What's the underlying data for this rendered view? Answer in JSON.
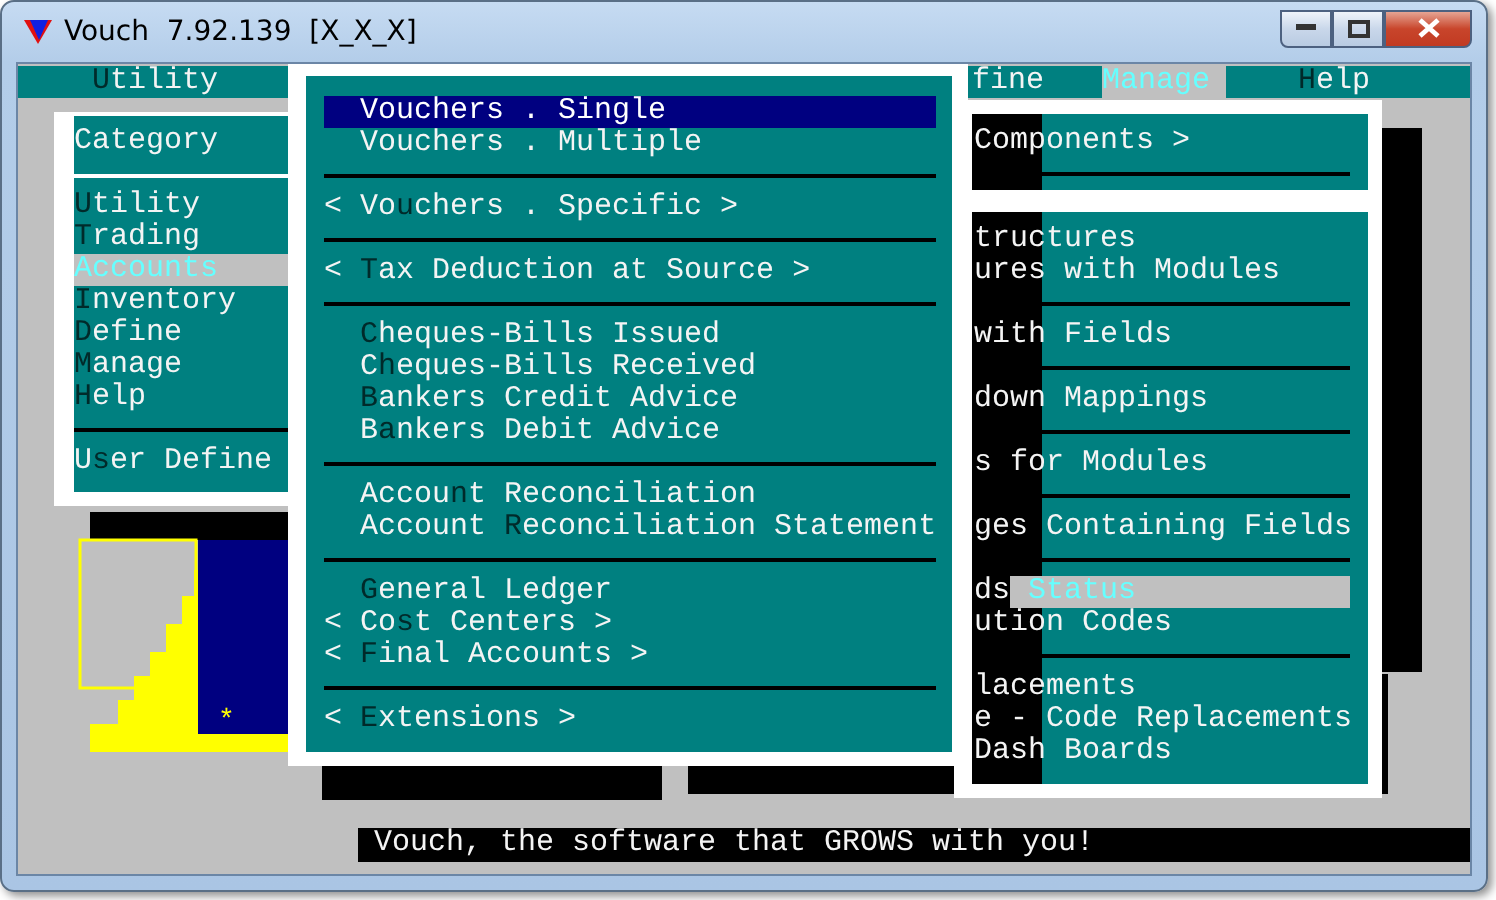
{
  "window": {
    "title": "Vouch  7.92.139  [X_X_X]"
  },
  "menu_bar": [
    {
      "hotkey": "U",
      "after": "tility",
      "selected": false
    },
    {
      "before": "fine",
      "selected": false
    },
    {
      "before": "Manage",
      "selected": true
    },
    {
      "hotkey": "H",
      "after": "elp",
      "selected": false
    }
  ],
  "left_panel": {
    "heading": "Category",
    "items": [
      {
        "hotkey": "U",
        "after": "tility",
        "selected": false
      },
      {
        "hotkey": "T",
        "after": "rading",
        "selected": false
      },
      {
        "before": "Accounts",
        "selected": true
      },
      {
        "hotkey": "I",
        "after": "nventory",
        "selected": false
      },
      {
        "hotkey": "D",
        "after": "efine",
        "selected": false
      },
      {
        "hotkey": "M",
        "after": "anage",
        "selected": false
      },
      {
        "hotkey": "H",
        "after": "elp",
        "selected": false
      }
    ],
    "footer_items": [
      {
        "before": "U",
        "hotkey": "s",
        "after": "er Define",
        "selected": false
      }
    ]
  },
  "accounts_menu": {
    "groups": [
      [
        {
          "kind": "command",
          "before": "Vouchers . Single",
          "selected": true
        },
        {
          "kind": "command",
          "before": "Vouchers . Multiple",
          "selected": false
        }
      ],
      [
        {
          "kind": "submenu",
          "before": "< Vo",
          "hotkey": "u",
          "after": "chers . Specific >",
          "selected": false
        }
      ],
      [
        {
          "kind": "submenu",
          "before": "< ",
          "hotkey": "T",
          "after": "ax Deduction at Source >",
          "selected": false
        }
      ],
      [
        {
          "kind": "command",
          "hotkey": "C",
          "after": "heques-Bills Issued",
          "selected": false
        },
        {
          "kind": "command",
          "before": "C",
          "hotkey": "h",
          "after": "eques-Bills Received",
          "selected": false
        },
        {
          "kind": "command",
          "hotkey": "B",
          "after": "ankers Credit Advice",
          "selected": false
        },
        {
          "kind": "command",
          "before": "B",
          "hotkey": "a",
          "after": "nkers Debit Advice",
          "selected": false
        }
      ],
      [
        {
          "kind": "command",
          "before": "Accou",
          "hotkey": "n",
          "after": "t Reconciliation",
          "selected": false
        },
        {
          "kind": "command",
          "before": "Account ",
          "hotkey": "R",
          "after": "econciliation Statement",
          "selected": false
        }
      ],
      [
        {
          "kind": "command",
          "hotkey": "G",
          "after": "eneral Ledger",
          "selected": false
        },
        {
          "kind": "submenu",
          "before": "< Co",
          "hotkey": "s",
          "after": "t Centers >",
          "selected": false
        },
        {
          "kind": "submenu",
          "before": "< ",
          "hotkey": "F",
          "after": "inal Accounts >",
          "selected": false
        }
      ],
      [
        {
          "kind": "submenu",
          "before": "< ",
          "hotkey": "E",
          "after": "xtensions >",
          "selected": false
        }
      ]
    ]
  },
  "manage_panel": {
    "top_items": [
      {
        "text": "Components >"
      }
    ],
    "groups": [
      [
        {
          "text": "tructures"
        },
        {
          "text": "ures with Modules"
        }
      ],
      [
        {
          "text": "with Fields"
        }
      ],
      [
        {
          "text": "down Mappings"
        }
      ],
      [
        {
          "text": "s for Modules"
        }
      ],
      [
        {
          "text": "ges Containing Fields"
        }
      ],
      [
        {
          "parts": [
            {
              "text": "ds",
              "selected": false
            },
            {
              "text": "Status",
              "selected": true
            }
          ]
        },
        {
          "text": "ution Codes"
        }
      ],
      [
        {
          "text": "lacements"
        },
        {
          "text": "e - Code Replacements"
        },
        {
          "text": "Dash Boards"
        }
      ]
    ]
  },
  "art": {
    "mark": "*"
  },
  "status_bar": {
    "text": "Vouch, the software that GROWS with you!"
  }
}
